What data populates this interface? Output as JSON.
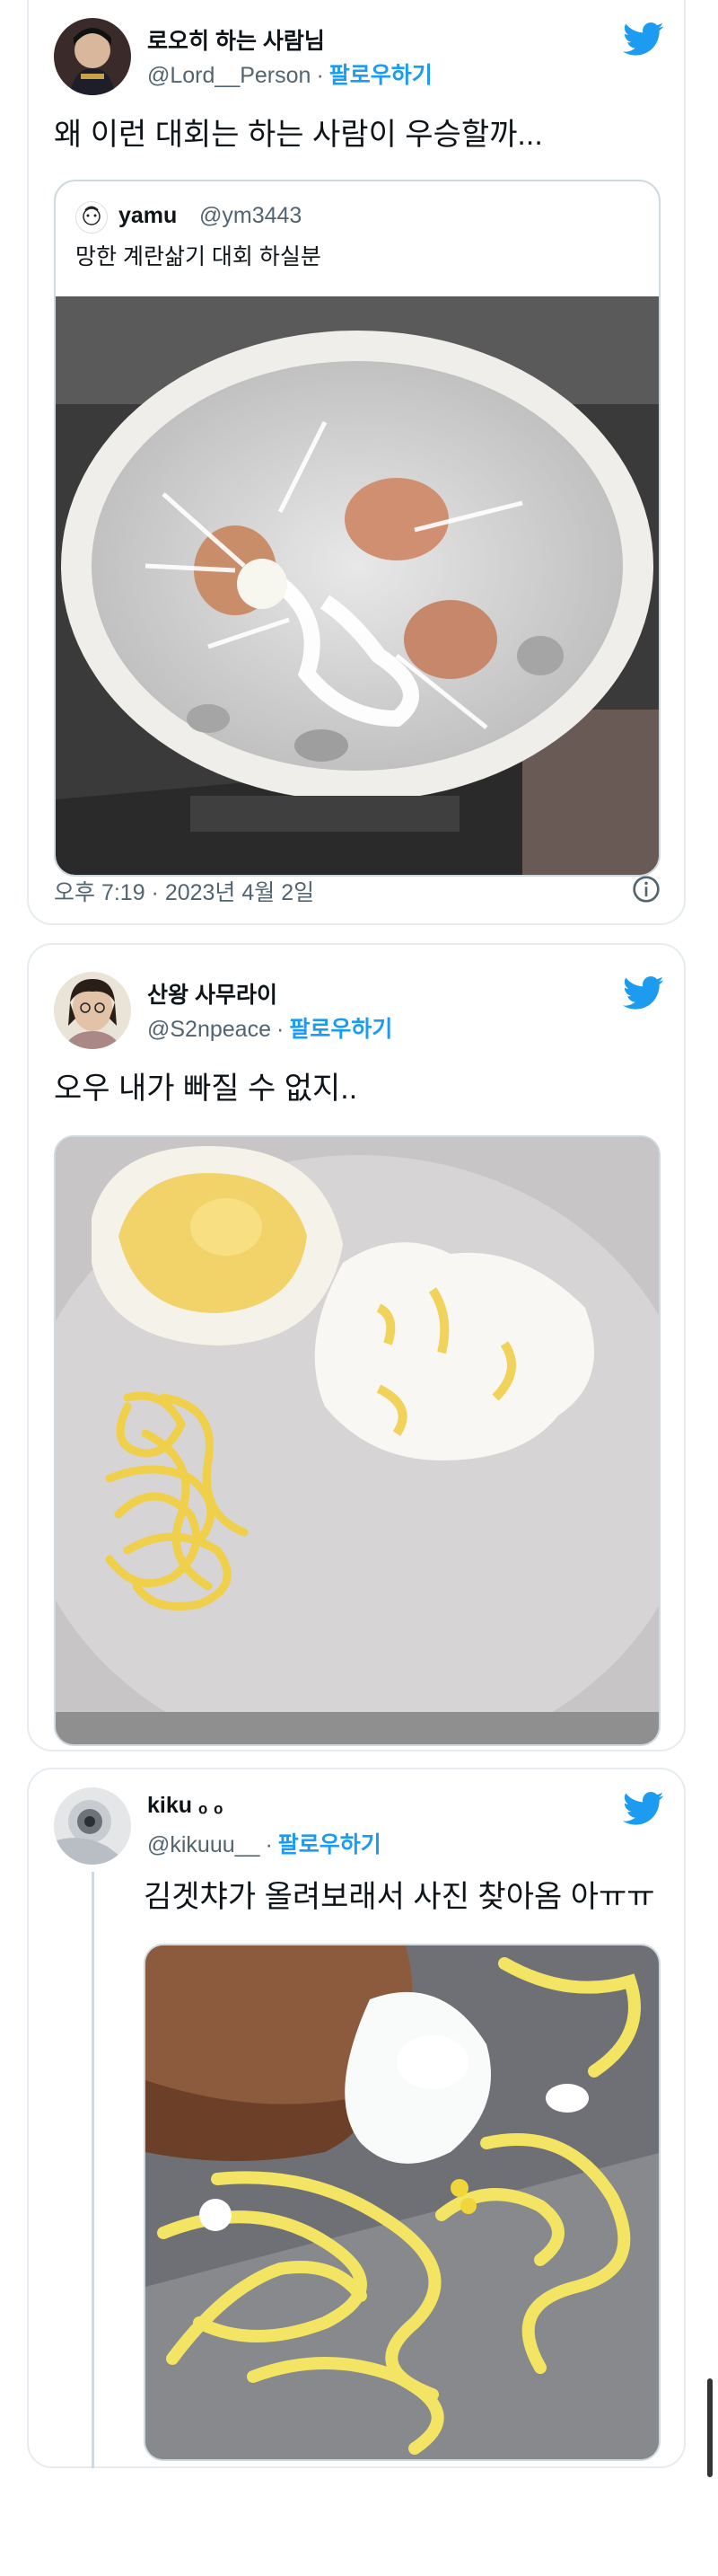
{
  "colors": {
    "accent": "#1d9bf0",
    "text": "#0f1419",
    "muted": "#536471",
    "border": "#e6ecf0"
  },
  "tweets": [
    {
      "name": "로오히 하는 사람님",
      "handle": "@Lord__Person",
      "follow_label": "팔로우하기",
      "text": "왜 이런 대회는 하는 사람이 우승할까...",
      "quote": {
        "name": "yamu",
        "handle": "@ym3443",
        "text": "망한 계란삶기 대회 하실분"
      },
      "timestamp": "오후 7:19 · 2023년 4월 2일",
      "icon": "info-icon"
    },
    {
      "name": "산왕 사무라이",
      "handle": "@S2npeace",
      "follow_label": "팔로우하기",
      "text": "오우 내가 빠질 수 없지.."
    },
    {
      "name": "kiku ₒ ₒ",
      "handle": "@kikuuu__",
      "follow_label": "팔로우하기",
      "text": "김겟챠가 올려보래서 사진 찾아옴 아ㅠㅠ"
    }
  ]
}
